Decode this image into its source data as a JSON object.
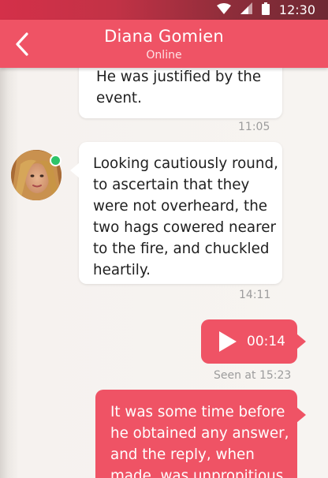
{
  "status_bar": {
    "time": "12:30",
    "icons": [
      "wifi-icon",
      "cellular-signal-icon",
      "battery-icon"
    ]
  },
  "header": {
    "contact_name": "Diana Gomien",
    "contact_status": "Online",
    "back_icon": "chevron-left-icon"
  },
  "messages": [
    {
      "direction": "incoming",
      "lines": [
        "He was justified by the",
        "event."
      ],
      "time": "11:05"
    },
    {
      "direction": "incoming",
      "lines": [
        "Looking cautiously round,",
        "to ascertain that they",
        "were not overheard, the",
        "two hags cowered nearer",
        "to the fire, and chuckled",
        "heartily."
      ],
      "time": "14:11",
      "avatar": "contact-avatar",
      "online": true
    },
    {
      "direction": "outgoing",
      "type": "voice",
      "duration": "00:14",
      "status": "Seen at 15:23"
    },
    {
      "direction": "outgoing",
      "lines": [
        "It was some time before",
        "he obtained any answer,",
        "and the reply, when",
        "made, was unpropitious."
      ]
    }
  ],
  "colors": {
    "accent": "#ef5365",
    "incoming_bubble": "#ffffff",
    "background": "#f7f4f1",
    "online": "#2ec468"
  }
}
